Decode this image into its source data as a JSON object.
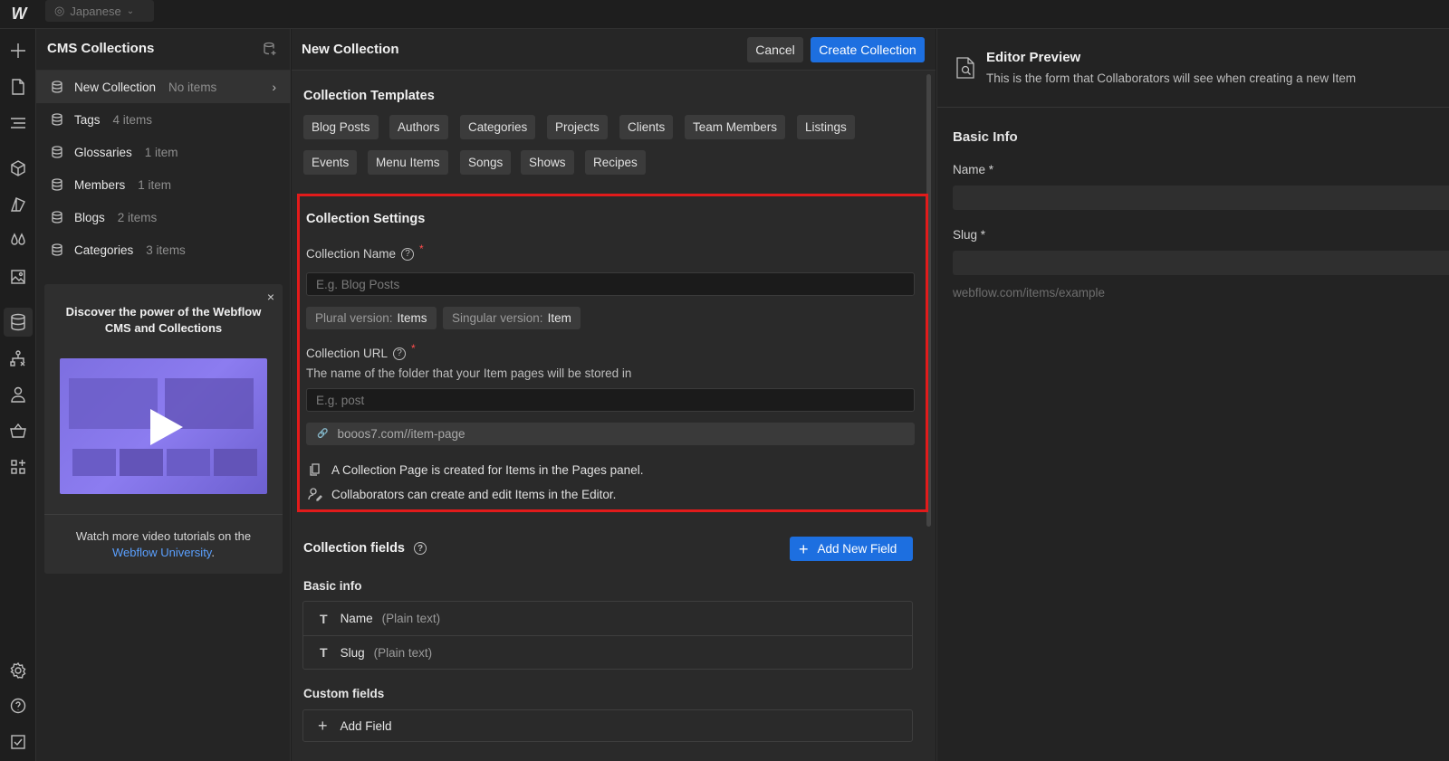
{
  "topbar": {
    "locale": "Japanese",
    "logo": "W"
  },
  "rail": {
    "icons": [
      "plus-icon",
      "page-icon",
      "navigator-icon",
      "box-icon",
      "style-icon",
      "color-drops-icon",
      "image-icon",
      "database-icon",
      "logic-flow-icon",
      "user-icon",
      "basket-icon",
      "apps-icon",
      "settings-gear-icon",
      "help-icon",
      "checkmark-icon"
    ]
  },
  "cms": {
    "title": "CMS Collections",
    "collections": [
      {
        "name": "New Collection",
        "count": "No items",
        "selected": true
      },
      {
        "name": "Tags",
        "count": "4 items"
      },
      {
        "name": "Glossaries",
        "count": "1 item"
      },
      {
        "name": "Members",
        "count": "1 item"
      },
      {
        "name": "Blogs",
        "count": "2 items"
      },
      {
        "name": "Categories",
        "count": "3 items"
      }
    ],
    "promo": {
      "close": "×",
      "title": "Discover the power of the Webflow CMS and Collections",
      "footer_prefix": "Watch more video tutorials on the",
      "footer_link": "Webflow University",
      "footer_suffix": "."
    }
  },
  "main": {
    "title": "New Collection",
    "cancel_label": "Cancel",
    "create_label": "Create Collection",
    "templates": {
      "title": "Collection Templates",
      "items": [
        "Blog Posts",
        "Authors",
        "Categories",
        "Projects",
        "Clients",
        "Team Members",
        "Listings",
        "Events",
        "Menu Items",
        "Songs",
        "Shows",
        "Recipes"
      ]
    },
    "settings": {
      "title": "Collection Settings",
      "name_label": "Collection Name",
      "name_placeholder": "E.g. Blog Posts",
      "plural_label": "Plural version:",
      "plural_value": "Items",
      "singular_label": "Singular version:",
      "singular_value": "Item",
      "url_label": "Collection URL",
      "url_hint": "The name of the folder that your Item pages will be stored in",
      "url_placeholder": "E.g. post",
      "url_preview": "booos7.com//item-page",
      "info_page": "A Collection Page is created for Items in the Pages panel.",
      "info_editor": "Collaborators can create and edit Items in the Editor.",
      "help_glyph": "?",
      "required_glyph": "*"
    },
    "fields": {
      "title": "Collection fields",
      "add_new_label": "Add New Field",
      "basic_title": "Basic info",
      "basic": [
        {
          "glyph": "T",
          "name": "Name",
          "type": "(Plain text)"
        },
        {
          "glyph": "T",
          "name": "Slug",
          "type": "(Plain text)"
        }
      ],
      "custom_title": "Custom fields",
      "add_field_label": "Add Field"
    }
  },
  "preview": {
    "title": "Editor Preview",
    "desc": "This is the form that Collaborators will see when creating a new Item",
    "section": "Basic Info",
    "name_label": "Name *",
    "slug_label": "Slug *",
    "url_example": "webflow.com/items/example"
  },
  "colors": {
    "accent": "#1d6fe0",
    "highlight_border": "#e11b1b",
    "link": "#5aa0ff"
  }
}
